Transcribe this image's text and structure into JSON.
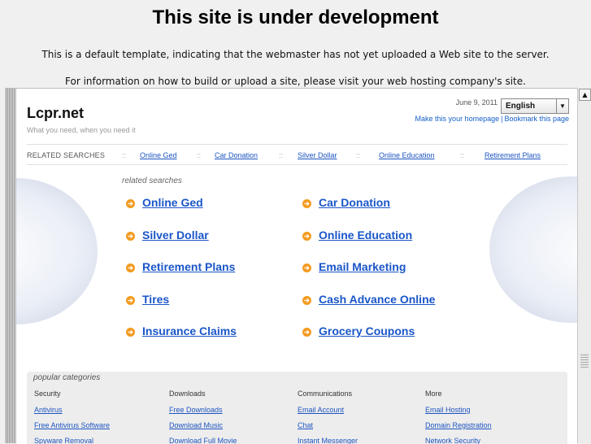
{
  "header": {
    "title": "This site is under development",
    "line1": "This is a default template, indicating that the webmaster has not yet uploaded a Web site to the server.",
    "line2": "For information on how to build or upload a site, please visit your web hosting company's site."
  },
  "site": {
    "logo": "Lcpr.net",
    "tagline": "What you need, when you need it",
    "date": "June 9, 2011",
    "language": "English",
    "make_homepage": "Make this your homepage",
    "bookmark": "Bookmark this page"
  },
  "related_bar": {
    "label": "RELATED SEARCHES",
    "separator": "::",
    "links": [
      "Online Ged",
      "Car Donation",
      "Silver Dollar",
      "Online Education",
      "Retirement Plans"
    ]
  },
  "related_searches": {
    "heading": "related searches",
    "bullet": "➔",
    "items": [
      "Online Ged",
      "Car Donation",
      "Silver Dollar",
      "Online Education",
      "Retirement Plans",
      "Email Marketing",
      "Tires",
      "Cash Advance Online",
      "Insurance Claims",
      "Grocery Coupons"
    ]
  },
  "popular": {
    "title": "popular categories",
    "columns": [
      {
        "heading": "Security",
        "items": [
          "Antivirus",
          "Free Antivirus Software",
          "Spyware Removal"
        ]
      },
      {
        "heading": "Downloads",
        "items": [
          "Free Downloads",
          "Download Music",
          "Download Full Movie"
        ]
      },
      {
        "heading": "Communications",
        "items": [
          "Email Account",
          "Chat",
          "Instant Messenger"
        ]
      },
      {
        "heading": "More",
        "items": [
          "Email Hosting",
          "Domain Registration",
          "Network Security"
        ]
      }
    ]
  },
  "colors": {
    "link": "#1a56c8",
    "bullet": "#f29b1f",
    "background": "#f0f0f0"
  }
}
